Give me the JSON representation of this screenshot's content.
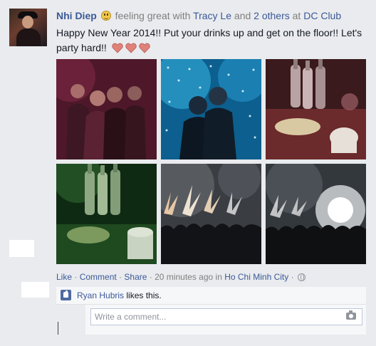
{
  "post": {
    "author": "Nhi Diep",
    "feeling": "feeling great",
    "with_word": "with",
    "tagged_person": "Tracy Le",
    "and_word": "and",
    "others": "2 others",
    "at_word": "at",
    "place": "DC Club",
    "message": "Happy New Year 2014!! Put your drinks up and get on the floor!! Let's party hard!!",
    "photos": [
      {
        "icon": "party-photo-friends"
      },
      {
        "icon": "party-photo-couple"
      },
      {
        "icon": "party-photo-bottles-table"
      },
      {
        "icon": "party-photo-bottles-green"
      },
      {
        "icon": "party-photo-fireworks-crowd"
      },
      {
        "icon": "party-photo-fireworks-stage"
      }
    ]
  },
  "actions": {
    "like": "Like",
    "comment": "Comment",
    "share": "Share",
    "sep": "·",
    "time": "20 minutes ago",
    "in_word": "in",
    "location": "Ho Chi Minh City"
  },
  "likes": {
    "liker": "Ryan Hubris",
    "suffix": "likes this."
  },
  "comment": {
    "placeholder": "Write a comment..."
  },
  "colors": {
    "link": "#3b5998",
    "background": "#e9ebee",
    "heart": "#e0827a"
  }
}
